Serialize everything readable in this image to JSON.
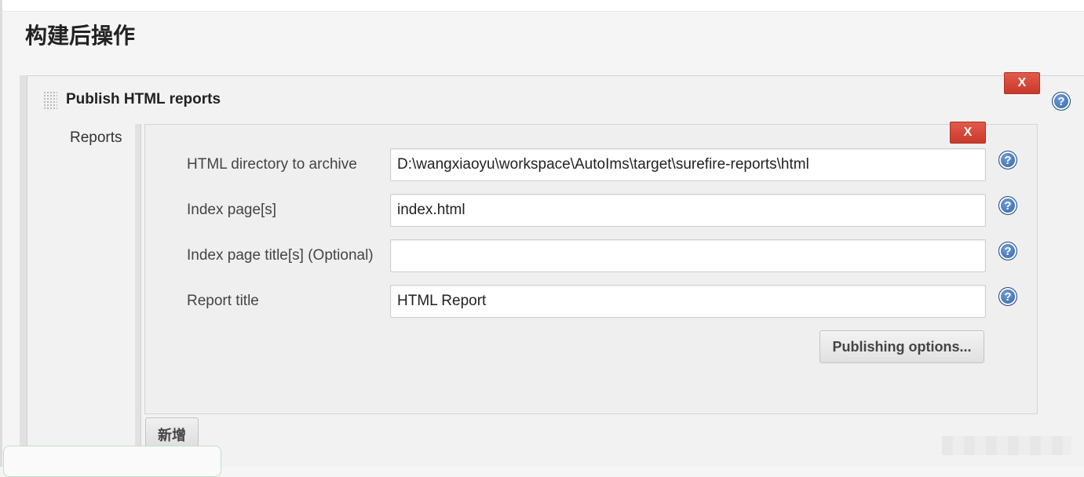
{
  "section": {
    "title": "构建后操作"
  },
  "publisher": {
    "title": "Publish HTML reports",
    "delete_label": "X",
    "help_glyph": "?",
    "reports_label": "Reports",
    "report": {
      "delete_label": "X",
      "fields": [
        {
          "label": "HTML directory to archive",
          "value": "D:\\wangxiaoyu\\workspace\\AutoIms\\target\\surefire-reports\\html"
        },
        {
          "label": "Index page[s]",
          "value": "index.html"
        },
        {
          "label": "Index page title[s] (Optional)",
          "value": ""
        },
        {
          "label": "Report title",
          "value": "HTML Report"
        }
      ],
      "publishing_options_label": "Publishing options..."
    },
    "add_label": "新增"
  },
  "icons": {
    "help": "help-icon",
    "drag": "drag-handle-icon"
  },
  "colors": {
    "delete_red": "#d9443a",
    "help_blue": "#2d5fa6"
  }
}
